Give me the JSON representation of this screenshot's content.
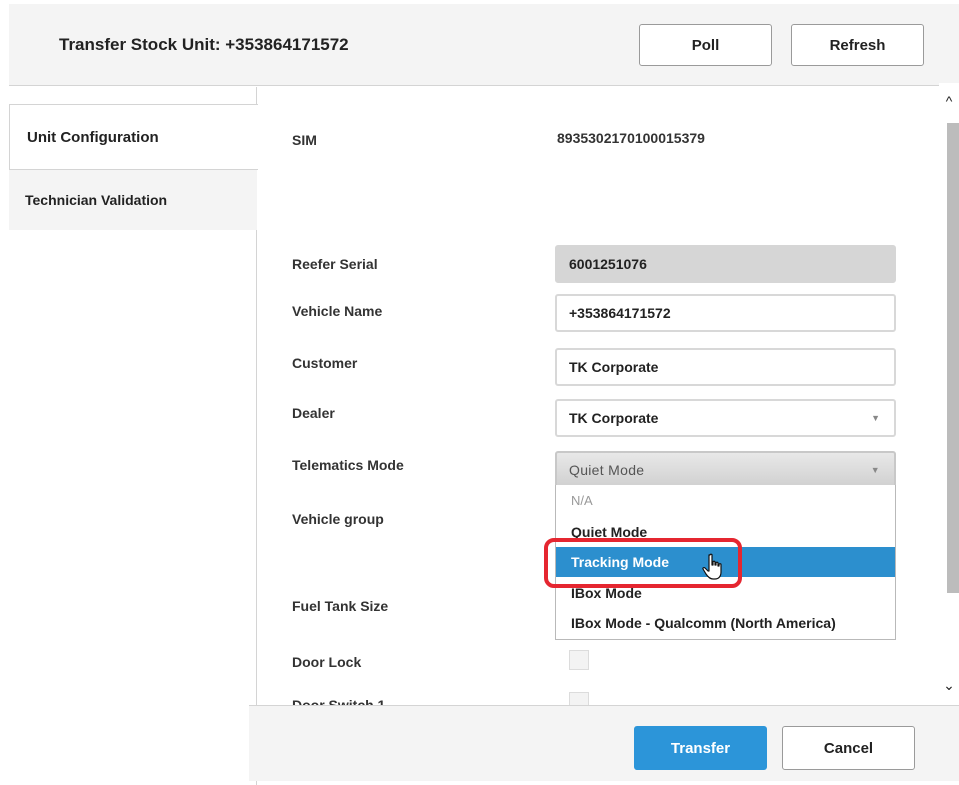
{
  "header": {
    "title": "Transfer Stock Unit: +353864171572",
    "poll_label": "Poll",
    "refresh_label": "Refresh"
  },
  "sidebar": {
    "tabs": [
      {
        "label": "Unit Configuration",
        "active": true
      },
      {
        "label": "Technician Validation",
        "active": false
      }
    ]
  },
  "form": {
    "sim": {
      "label": "SIM",
      "value": "8935302170100015379"
    },
    "reefer_serial": {
      "label": "Reefer Serial",
      "value": "6001251076"
    },
    "vehicle_name": {
      "label": "Vehicle Name",
      "value": "+353864171572"
    },
    "customer": {
      "label": "Customer",
      "value": "TK Corporate"
    },
    "dealer": {
      "label": "Dealer",
      "value": "TK Corporate"
    },
    "telematics_mode": {
      "label": "Telematics Mode",
      "value": "Quiet Mode",
      "options": [
        "N/A",
        "Quiet Mode",
        "Tracking Mode",
        "IBox Mode",
        "IBox Mode - Qualcomm (North America)"
      ],
      "highlighted": "Tracking Mode"
    },
    "vehicle_group": {
      "label": "Vehicle group"
    },
    "fuel_tank_size": {
      "label": "Fuel Tank Size"
    },
    "door_lock": {
      "label": "Door Lock"
    },
    "door_switch_1": {
      "label": "Door Switch 1"
    }
  },
  "footer": {
    "transfer_label": "Transfer",
    "cancel_label": "Cancel"
  },
  "colors": {
    "accent": "#2c95d9",
    "selected_option": "#2c8fce",
    "highlight_box": "#e52630"
  }
}
